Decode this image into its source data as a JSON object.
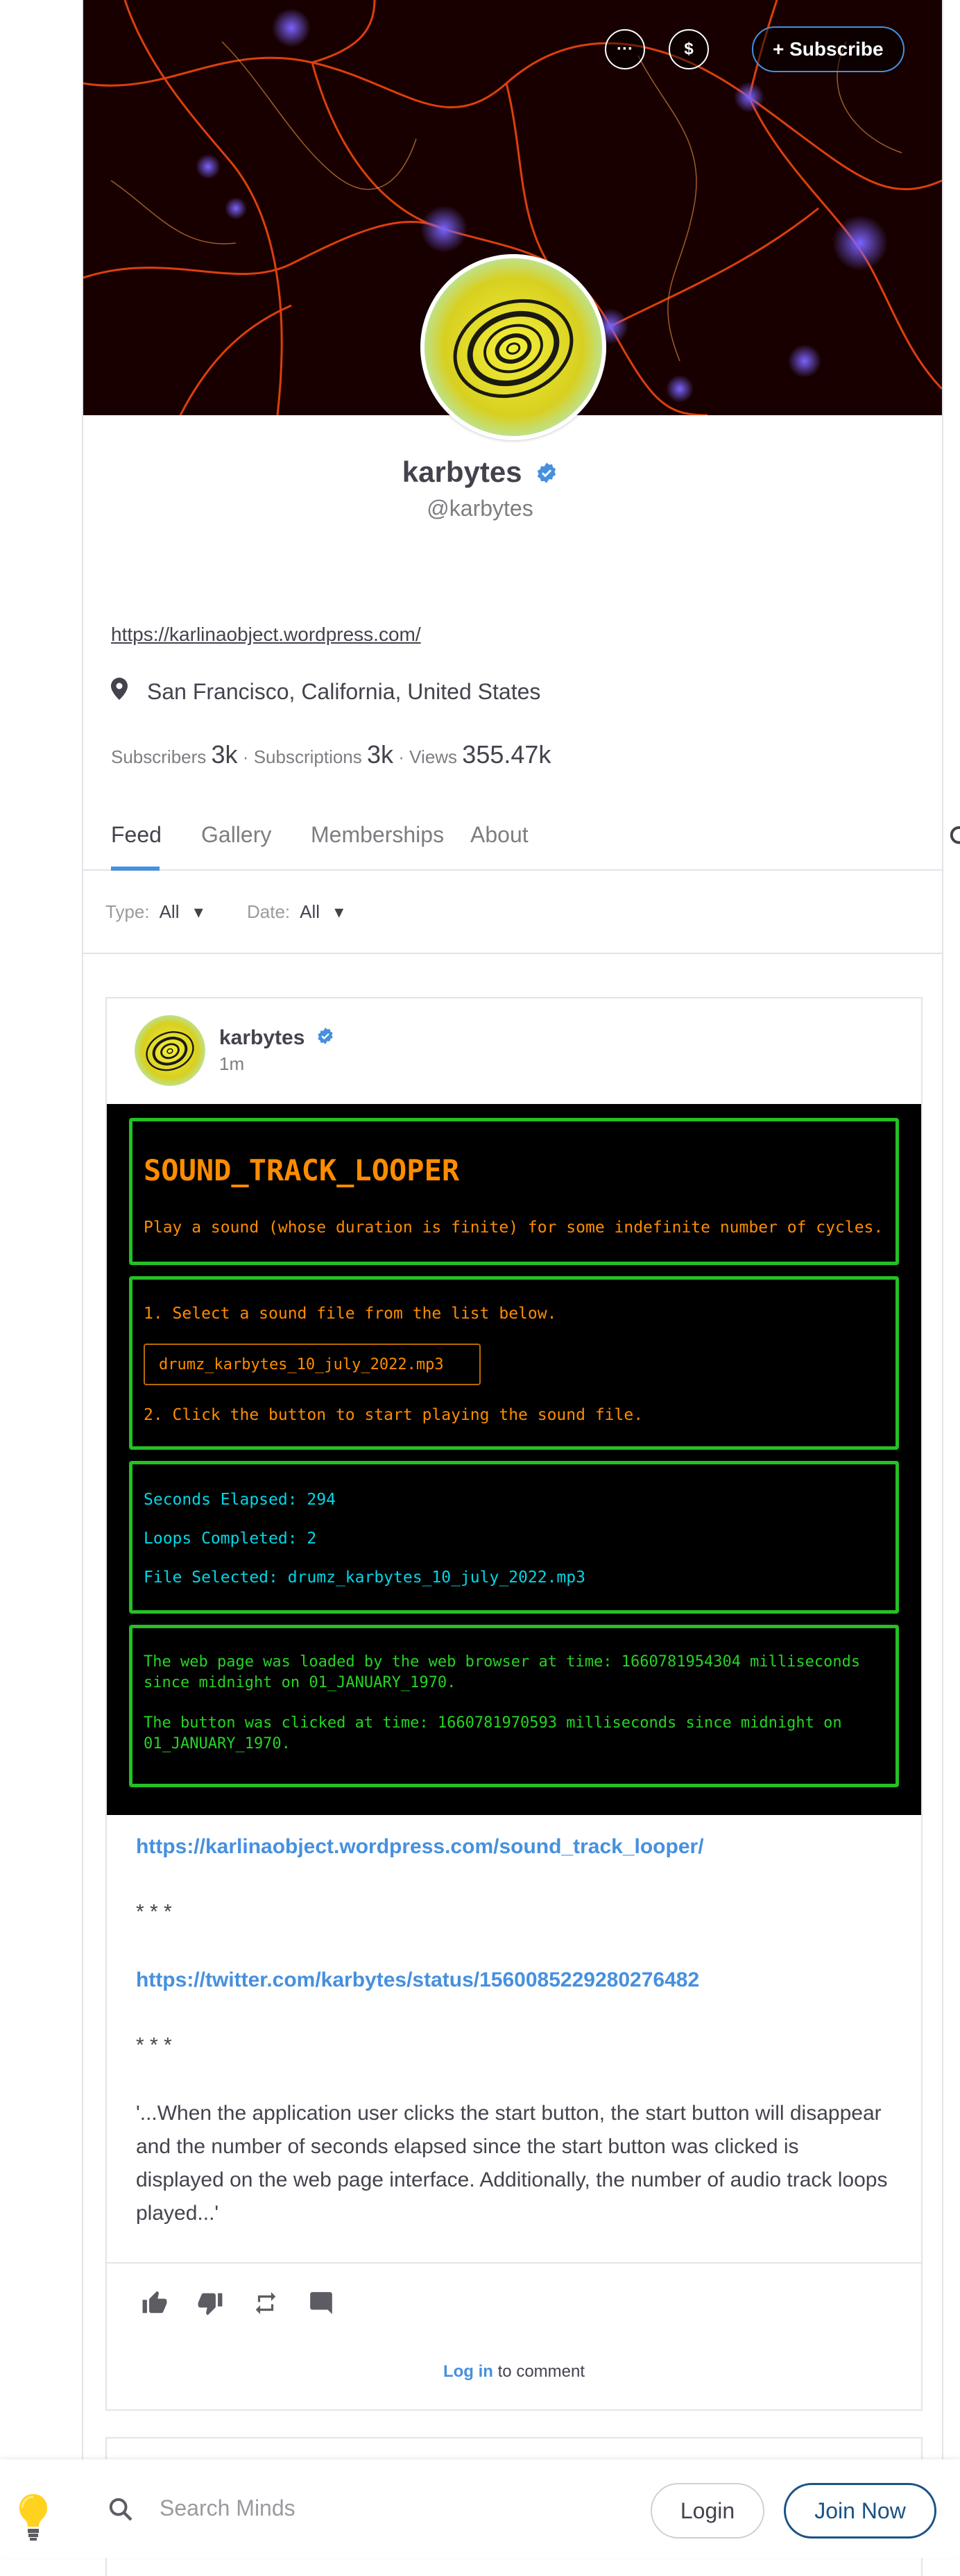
{
  "banner": {
    "more_label": "···",
    "tip_label": "$",
    "subscribe_label": "+ Subscribe"
  },
  "profile": {
    "name": "karbytes",
    "handle": "@karbytes",
    "website": "https://karlinaobject.wordpress.com/",
    "location": "San Francisco, California, United States",
    "stats": {
      "subscribers_label": "Subscribers",
      "subscribers": "3k",
      "subscriptions_label": "Subscriptions",
      "subscriptions": "3k",
      "views_label": "Views",
      "views": "355.47k",
      "separator": "·"
    }
  },
  "tabs": [
    "Feed",
    "Gallery",
    "Memberships",
    "About"
  ],
  "filters": {
    "type_label": "Type:",
    "type_value": "All",
    "date_label": "Date:",
    "date_value": "All",
    "caret": "▾"
  },
  "post": {
    "author": "karbytes",
    "time": "1m",
    "embed": {
      "title": "SOUND_TRACK_LOOPER",
      "description": "Play a sound (whose duration is finite) for some indefinite number of cycles.",
      "step1": "1. Select a sound file from the list below.",
      "selected_file": "drumz_karbytes_10_july_2022.mp3",
      "step2": "2. Click the button to start playing the sound file.",
      "seconds_elapsed": "Seconds Elapsed: 294",
      "loops_completed": "Loops Completed: 2",
      "file_selected": "File Selected: drumz_karbytes_10_july_2022.mp3",
      "load_time": "The web page was loaded by the web browser at time: 1660781954304 milliseconds since midnight on 01_JANUARY_1970.",
      "click_time": "The button was clicked at time: 1660781970593 milliseconds since midnight on 01_JANUARY_1970."
    },
    "link1": "https://karlinaobject.wordpress.com/sound_track_looper/",
    "sep1": "* * *",
    "link2": "https://twitter.com/karbytes/status/1560085229280276482",
    "sep2": "* * *",
    "quote": "'...When the application user clicks the start button, the start button will disappear and the number of seconds elapsed since the start button was clicked is displayed on the web page interface. Additionally, the number of audio track loops played...'",
    "actions": [
      "thumbs-up-icon",
      "thumbs-down-icon",
      "remind-icon",
      "comment-icon"
    ],
    "login_link": "Log in",
    "login_suffix": " to comment"
  },
  "bottombar": {
    "search_placeholder": "Search Minds",
    "login_label": "Login",
    "join_label": "Join Now"
  },
  "colors": {
    "accent": "#4690df",
    "embed_green": "#24c124",
    "embed_orange": "#ff8c00",
    "embed_cyan": "#00d7e6"
  }
}
